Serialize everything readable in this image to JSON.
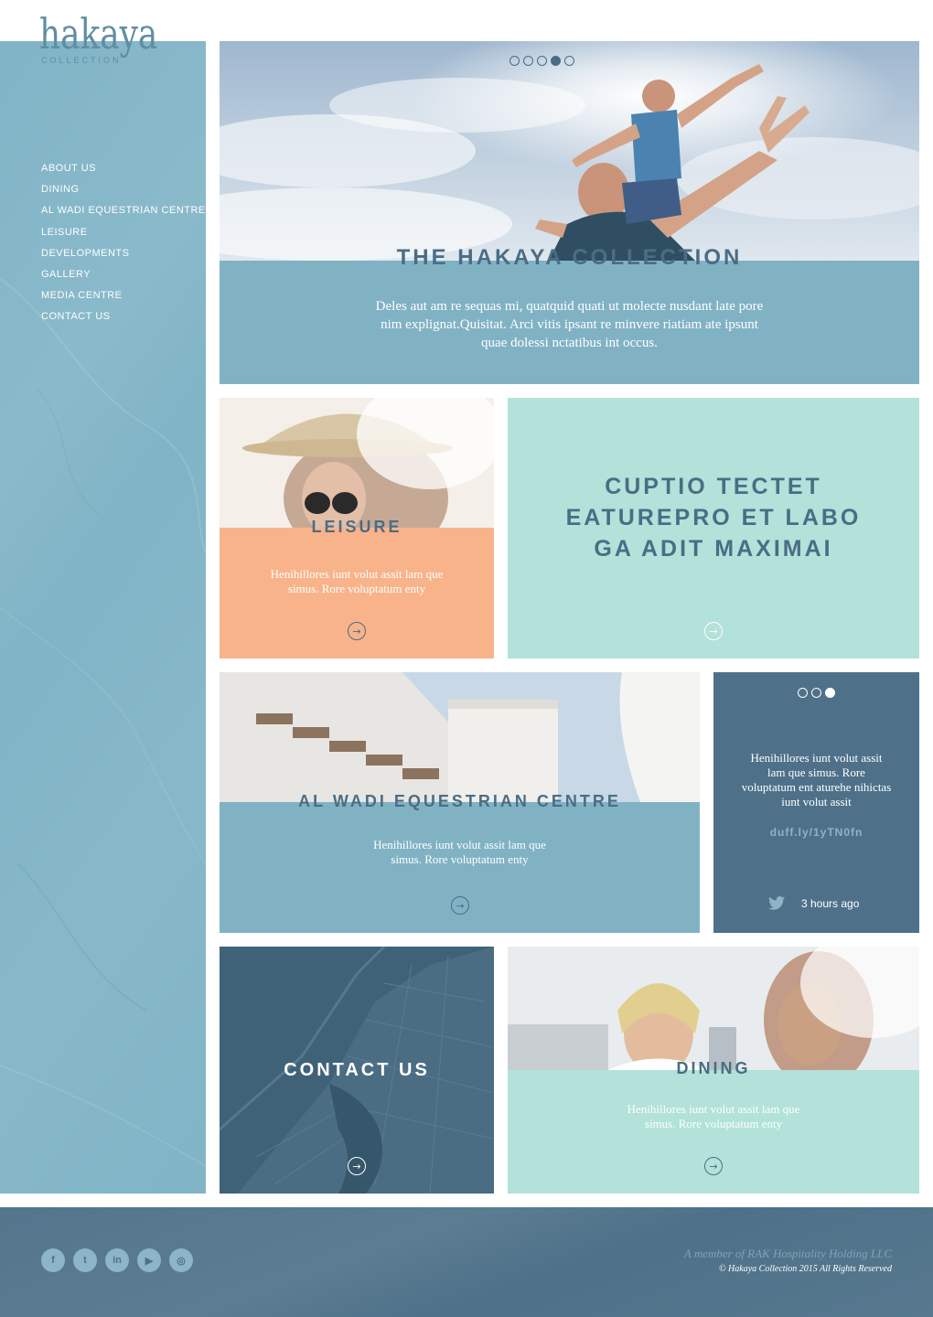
{
  "brand": {
    "logo_word": "hakaya",
    "logo_sub": "COLLECTION"
  },
  "nav": {
    "items": [
      {
        "label": "ABOUT US"
      },
      {
        "label": "DINING"
      },
      {
        "label": "AL WADI EQUESTRIAN CENTRE"
      },
      {
        "label": "LEISURE"
      },
      {
        "label": "DEVELOPMENTS"
      },
      {
        "label": "GALLERY"
      },
      {
        "label": "MEDIA CENTRE"
      },
      {
        "label": "CONTACT US"
      }
    ]
  },
  "hero": {
    "title": "THE HAKAYA COLLECTION",
    "text": "Deles aut am re sequas mi, quatquid quati ut molecte nusdant late pore nim explignat.Quisitat. Arci vitis ipsant re minvere riatiam ate ipsunt quae dolessi nctatibus int occus.",
    "slides": 5,
    "active_slide": 4
  },
  "leisure": {
    "title": "LEISURE",
    "text": "Henihillores iunt volut assit lam que simus. Rore voluptatum enty"
  },
  "feature": {
    "lines": [
      "CUPTIO TECTET",
      "EATUREPRO ET LABO",
      "GA ADIT MAXIMAI"
    ]
  },
  "equestrian": {
    "title": "AL WADI EQUESTRIAN CENTRE",
    "text": "Henihillores iunt volut assit lam que simus. Rore voluptatum enty"
  },
  "tweet": {
    "text": "Henihillores iunt volut assit lam que simus. Rore voluptatum ent aturehe nihictas iunt volut assit",
    "link": "duff.ly/1yTN0fn",
    "time": "3 hours ago",
    "slides": 3,
    "active_slide": 3
  },
  "contact": {
    "title": "CONTACT US"
  },
  "dining": {
    "title": "DINING",
    "text": "Henihillores iunt volut assit lam que simus. Rore voluptatum enty"
  },
  "footer": {
    "social": [
      {
        "icon": "facebook-icon",
        "glyph": "f"
      },
      {
        "icon": "twitter-icon",
        "glyph": "t"
      },
      {
        "icon": "linkedin-icon",
        "glyph": "in"
      },
      {
        "icon": "youtube-icon",
        "glyph": "▶"
      },
      {
        "icon": "instagram-icon",
        "glyph": "◎"
      }
    ],
    "member": "A member of RAK Hospitality Holding LLC",
    "copyright": "© Hakaya Collection 2015 All Rights Reserved"
  },
  "colors": {
    "sidebar": "#80b4c6",
    "hero_panel": "#80b2c4",
    "leisure_panel": "#f8b38b",
    "feature_panel": "#b2e2d9",
    "tweet_panel": "#4e7189",
    "contact_panel": "#3f6278",
    "footer": "#4e7189",
    "title_dark": "#4a6d85"
  }
}
